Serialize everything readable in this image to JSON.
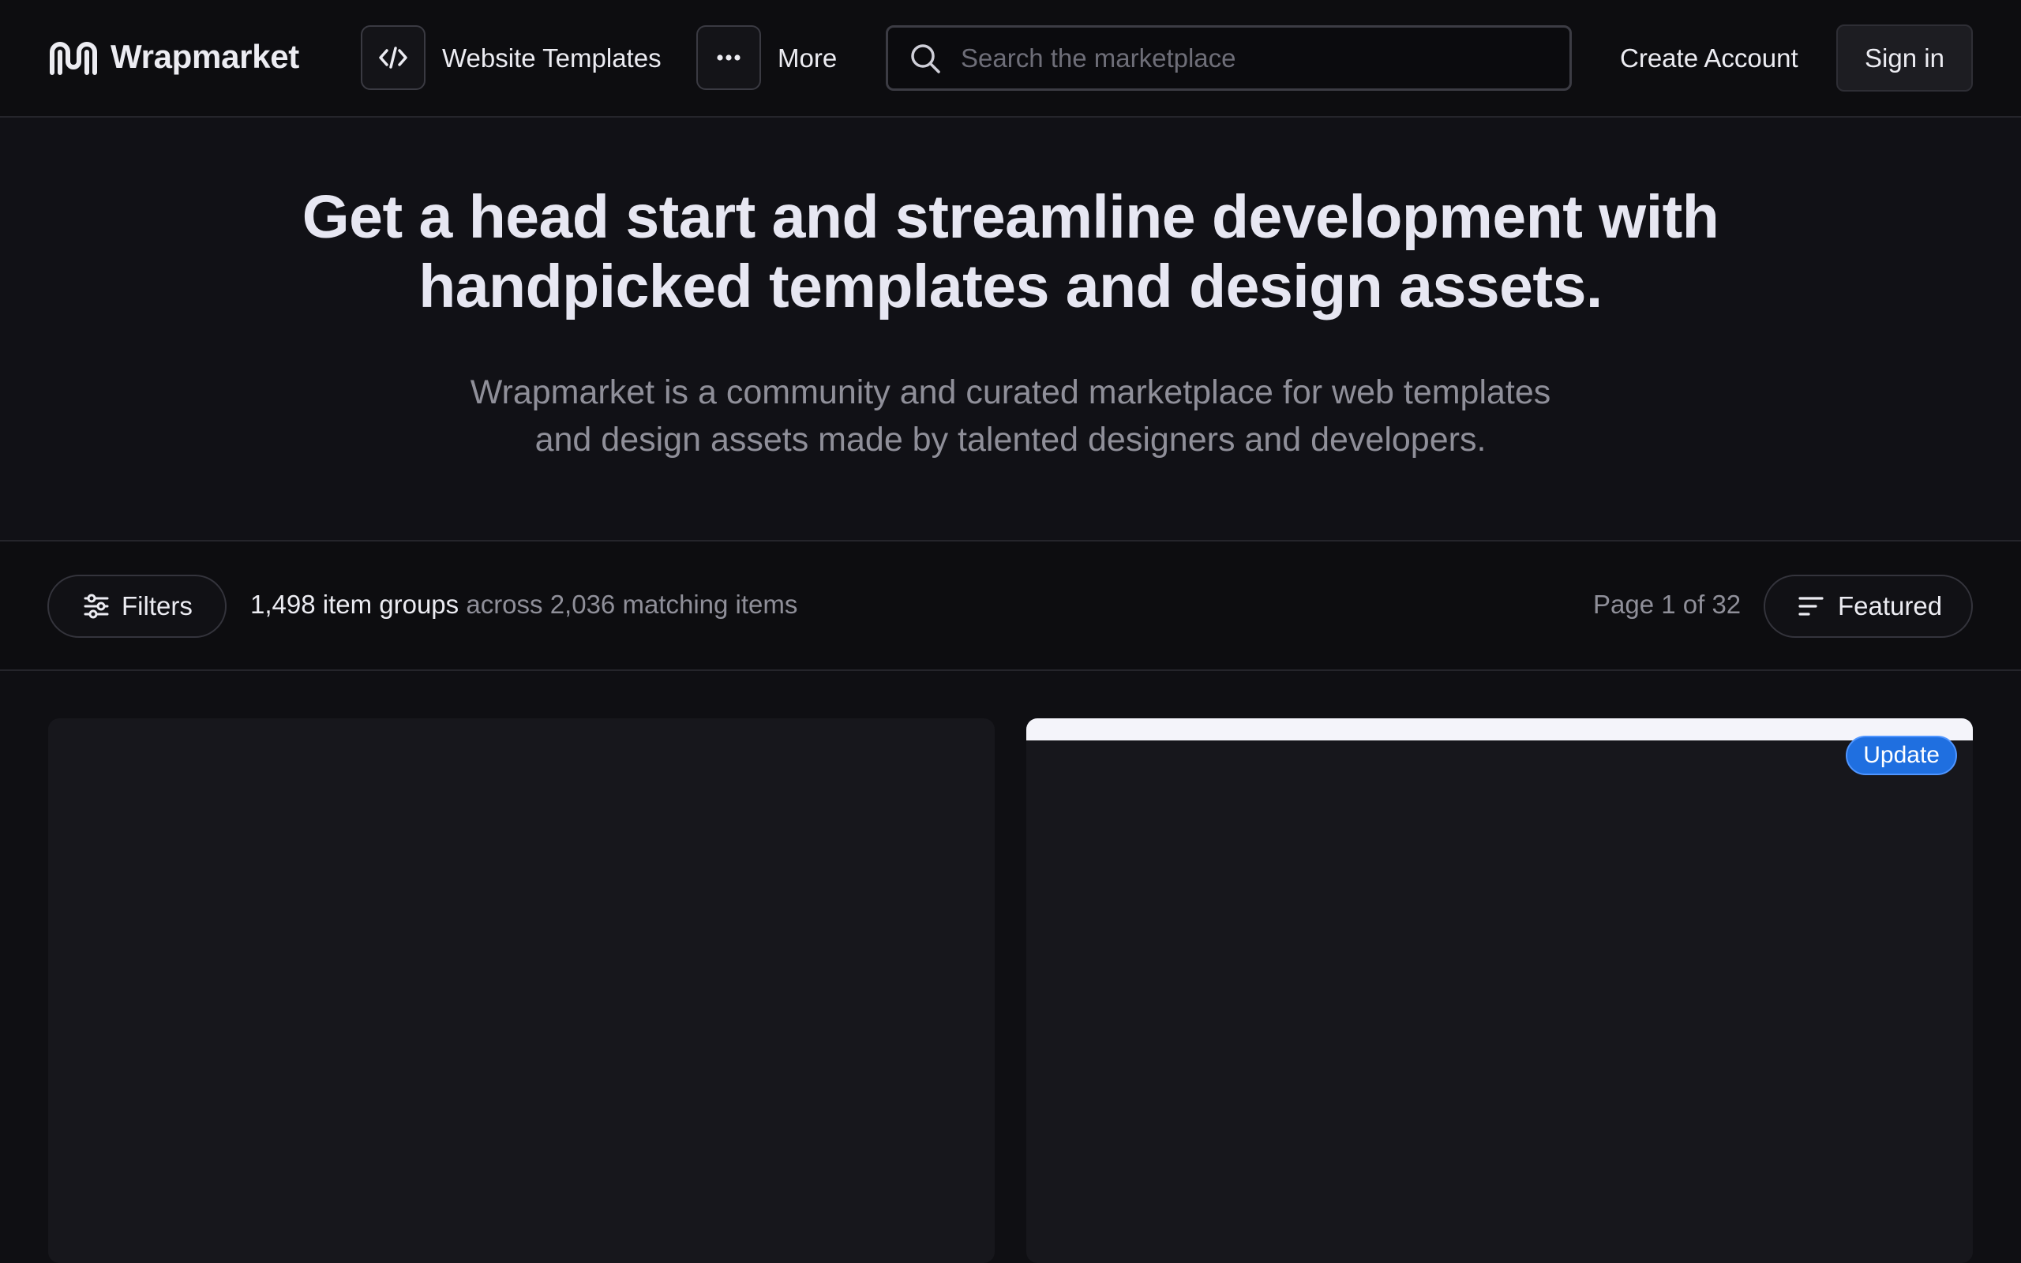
{
  "brand": {
    "name": "Wrapmarket"
  },
  "nav": {
    "primary_label": "Website Templates",
    "more_label": "More"
  },
  "search": {
    "placeholder": "Search the marketplace",
    "value": ""
  },
  "auth": {
    "create_account": "Create Account",
    "sign_in": "Sign in"
  },
  "hero": {
    "title_line1": "Get a head start and streamline development with",
    "title_line2": "handpicked templates and design assets.",
    "subtitle_line1": "Wrapmarket is a community and curated marketplace for web templates",
    "subtitle_line2": "and design assets made by talented designers and developers."
  },
  "toolbar": {
    "filters_label": "Filters",
    "groups_count": "1,498 item groups",
    "items_count": "across 2,036 matching items",
    "page_label": "Page 1 of 32",
    "sort_label": "Featured"
  },
  "cards": [
    {
      "badge": ""
    },
    {
      "badge": "Update"
    }
  ],
  "colors": {
    "background": "#0f0f13",
    "accent": "#1f6fe0",
    "text": "#ececf2",
    "muted": "#8f8f99"
  }
}
